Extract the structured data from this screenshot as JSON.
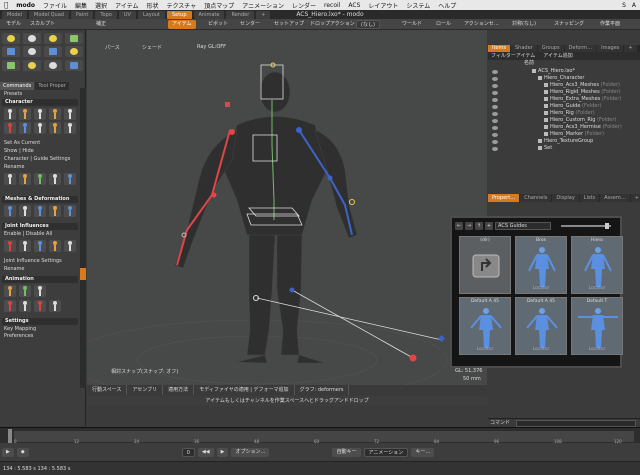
{
  "menubar": {
    "app": "modo",
    "items": [
      "ファイル",
      "編集",
      "選択",
      "アイテム",
      "形状",
      "テクスチャ",
      "頂点マップ",
      "アニメーション",
      "レンダー",
      "recoil",
      "ACS",
      "レイアウト",
      "システム",
      "ヘルプ"
    ],
    "right": [
      "S",
      "A"
    ]
  },
  "modebar": {
    "tabs": [
      "Model",
      "Model Quad",
      "Paint",
      "Topo",
      "UV",
      "Layout",
      "Setup",
      "Animate",
      "Render",
      "+"
    ],
    "active_index": 6,
    "window_title": "ACS_Hiero.lxo* - modo"
  },
  "toolbar": {
    "items": [
      "モデル",
      "スカルプト",
      "補正",
      "アイテム",
      "ピボット",
      "センター",
      "セットアップ",
      "ドロップアクション",
      "(なし)",
      "ワールド",
      "ロール",
      "アクションセ…",
      "対称(なし)",
      "スナッピング",
      "作業平面"
    ],
    "selected": "アイテム"
  },
  "left": {
    "tabs": [
      "Commands",
      "Tool Proper"
    ],
    "presets": "Presets",
    "sections": {
      "character": "Character",
      "meshes": "Meshes & Deformation",
      "joint": "Joint Influences",
      "animation": "Animation",
      "settings": "Settings"
    },
    "items": {
      "set_current": "Set As Current",
      "show_hide": "Show | Hide",
      "char_guide": "Character | Guide Settings",
      "rename1": "Rename",
      "enable_disable": "Enable | Disable All",
      "joint_settings": "Joint Influence Settings",
      "rename2": "Rename",
      "key_mapping": "Key Mapping",
      "preferences": "Preferences"
    }
  },
  "viewport": {
    "view_label": "パース",
    "shade_label": "シェード",
    "gl_label": "Ray GL:OFF",
    "snap_info": "相対スナップ(スナップ: オフ)",
    "gl_stats": "GL: 51,376",
    "units": "50 mm"
  },
  "status": {
    "cells": [
      "行動スペース",
      "アセンブリ",
      "適用方法",
      "モディファイヤの適用 | デフォーマ追加",
      "グラフ: deformers"
    ],
    "hint": "アイテムもしくはチャンネルを作業スペースへとドラッグアンドドロップ"
  },
  "right": {
    "tabs": [
      "Items",
      "Shader",
      "Groups",
      "Deform…",
      "Images",
      "+"
    ],
    "header": [
      "フィルターアイテム",
      "アイテム追加"
    ],
    "tree_name": "名前",
    "tree": [
      {
        "label": "ACS_Hiero.lxo*",
        "indent": 0
      },
      {
        "label": "Hiero_Character",
        "indent": 1
      },
      {
        "label": "Hiero_Acs3_Meshes",
        "tag": "(Folder)",
        "indent": 2
      },
      {
        "label": "Hiero_Rigid_Meshes",
        "tag": "(Folder)",
        "indent": 2
      },
      {
        "label": "Hiero_Extra_Meshes",
        "tag": "(Folder)",
        "indent": 2
      },
      {
        "label": "Hiero_Guide",
        "tag": "(Folder)",
        "indent": 2
      },
      {
        "label": "Hiero_Rig",
        "tag": "(Folder)",
        "indent": 2
      },
      {
        "label": "Hiero_Custom_Rig",
        "tag": "(Folder)",
        "indent": 2
      },
      {
        "label": "Hiero_Acs3_Hermise",
        "tag": "(Folder)",
        "indent": 2
      },
      {
        "label": "Hiero_Marker",
        "tag": "(Folder)",
        "indent": 2
      },
      {
        "label": "Hiero_TextureGroup",
        "indent": 1
      },
      {
        "label": "Set",
        "indent": 1
      }
    ],
    "prop_tabs": [
      "Propert…",
      "Channels",
      "Display",
      "Lists",
      "Assem…",
      "+"
    ]
  },
  "preset_browser": {
    "path": "ACS Guides",
    "cards": [
      {
        "title": "(dir)",
        "sub": ""
      },
      {
        "title": "Bros",
        "sub": "Locator"
      },
      {
        "title": "Hiero",
        "sub": "Locator"
      },
      {
        "title": "Default A 45",
        "sub": "Locator"
      },
      {
        "title": "Default A 45",
        "sub": "Locator"
      },
      {
        "title": "Default T",
        "sub": "Locator"
      }
    ]
  },
  "command": {
    "label": "コマンド"
  },
  "timeline": {
    "ticks": [
      "0",
      "12",
      "24",
      "36",
      "48",
      "60",
      "72",
      "84",
      "96",
      "108",
      "120"
    ]
  },
  "bottom": {
    "items": [
      "オプション…",
      "自動キー",
      "アニメーション",
      "キー…"
    ],
    "frame": "0"
  },
  "footer": {
    "coords": "134 : 5.583 s  134 : 5.583 s"
  },
  "colors": {
    "accent": "#d87a1c",
    "bg": "#3b3b3b",
    "viewport": "#474848"
  }
}
